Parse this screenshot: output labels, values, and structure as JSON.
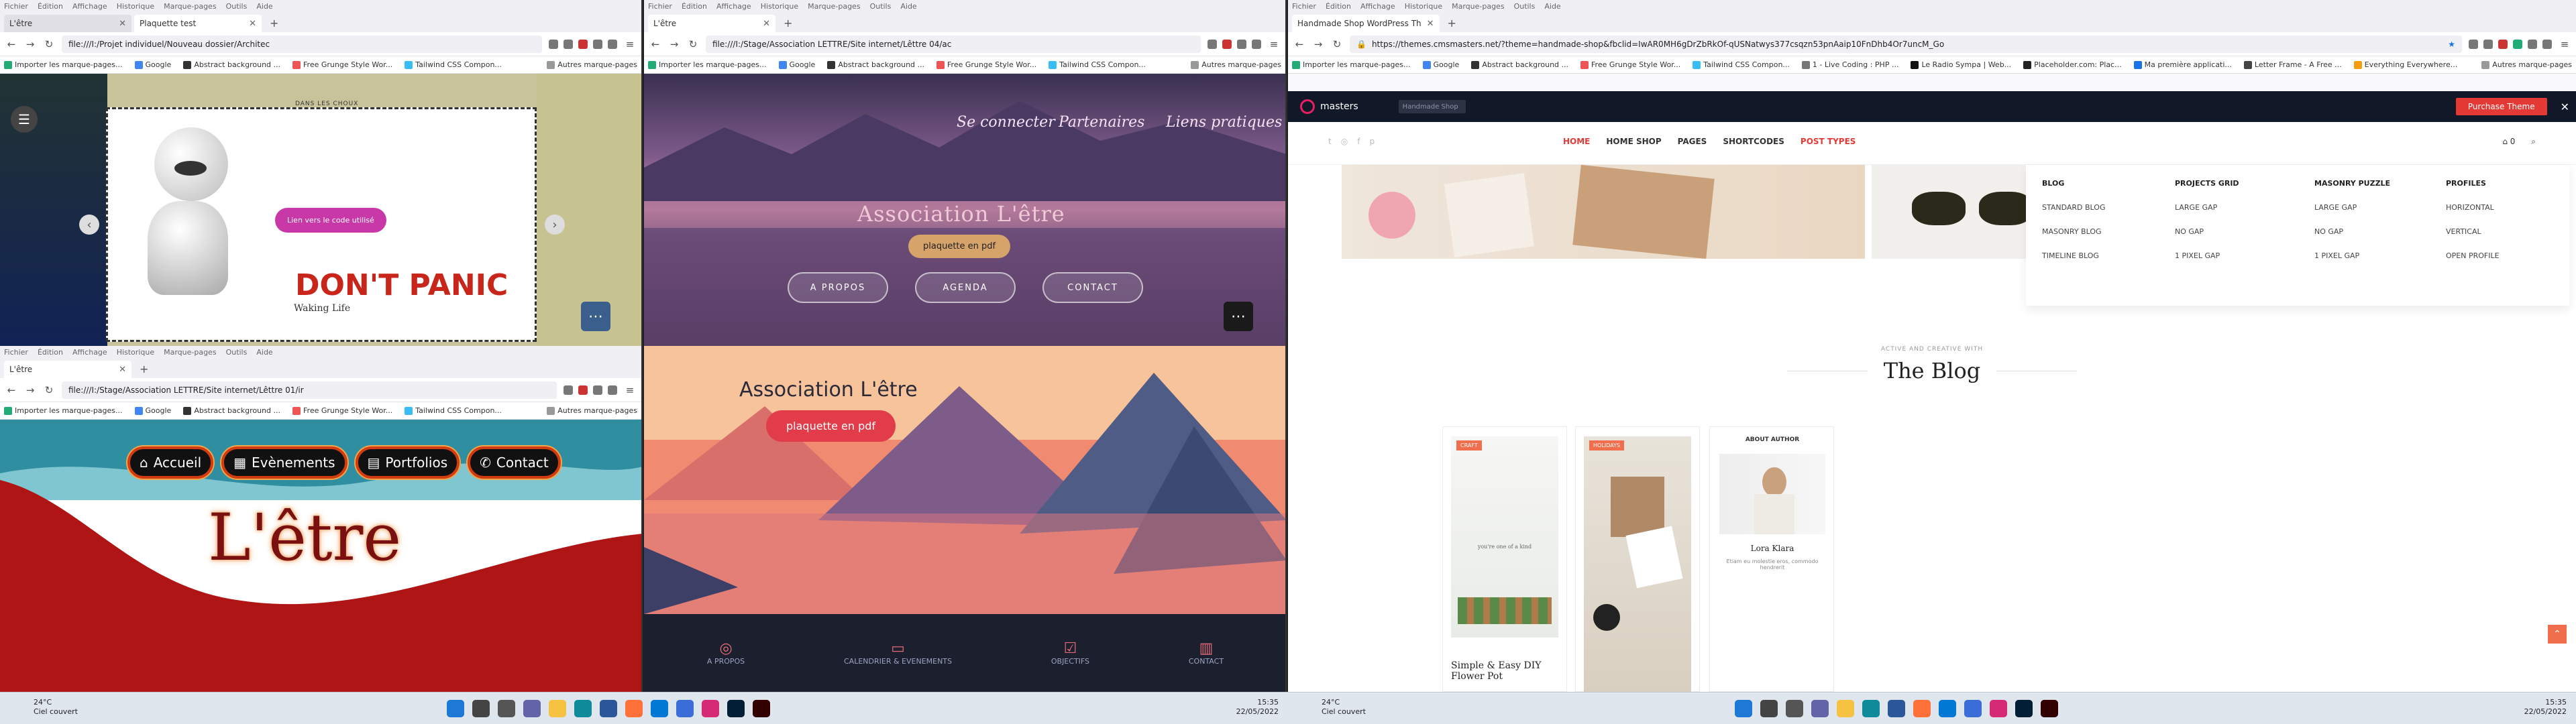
{
  "menus": [
    "Fichier",
    "Édition",
    "Affichage",
    "Historique",
    "Marque-pages",
    "Outils",
    "Aide"
  ],
  "bookmarks_common": [
    "Importer les marque-pages...",
    "Google",
    "Abstract background ...",
    "Free Grunge Style Wor...",
    "Tailwind CSS Compon..."
  ],
  "bookmarks_other": "Autres marque-pages",
  "win1": {
    "tabs": [
      "L'être",
      "Plaquette test"
    ],
    "url": "file:///I:/Projet individuel/Nouveau dossier/Architec",
    "top_small": "DANS LES CHOUX",
    "pill": "Lien vers le code utilisé",
    "dont_panic": "DON'T PANIC",
    "caption": "Waking Life",
    "prev": "‹",
    "next": "›",
    "more": "⋯"
  },
  "win2": {
    "tabs": [
      "L'être"
    ],
    "url": "file:///I:/Stage/Association LETTRE/Site internet/Lêttre 04/ac",
    "nav": [
      "Se connecter",
      "Partenaires",
      "Liens pratiques"
    ],
    "title": "Association L'être",
    "pdf": "plaquette en pdf",
    "buttons": [
      "A PROPOS",
      "AGENDA",
      "CONTACT"
    ],
    "more": "⋯"
  },
  "win3": {
    "tabs": [
      "L'être"
    ],
    "url": "file:///I:/Stage/Association LETTRE/Site internet/Lêttre 01/ir",
    "nav": [
      "Accueil",
      "Evènements",
      "Portfolios",
      "Contact"
    ],
    "title": "L'être"
  },
  "win4": {
    "title": "Association L'être",
    "pdf": "plaquette en pdf",
    "footer": [
      "A PROPOS",
      "CALENDRIER & EVENEMENTS",
      "OBJECTIFS",
      "CONTACT"
    ]
  },
  "win5": {
    "tabs": [
      "Handmade Shop WordPress Th"
    ],
    "url": "https://themes.cmsmasters.net/?theme=handmade-shop&fbclid=IwAR0MH6gDrZbRkOf-qUSNatwys377csqzn53pnAaip10FnDhb4Or7uncM_Go",
    "bookmarks_extra": [
      "1 - Live Coding : PHP ...",
      "Le Radio Sympa | Web...",
      "Placeholder.com: Plac...",
      "Ma première applicati...",
      "Letter Frame - A Free ...",
      "Everything Everywhere..."
    ],
    "brand": "masters",
    "search_label": "Handmade Shop",
    "purchase": "Purchase Theme",
    "main_nav": [
      "HOME",
      "HOME SHOP",
      "PAGES",
      "SHORTCODES",
      "POST TYPES"
    ],
    "cart_count": "0",
    "mega": [
      {
        "head": "BLOG",
        "items": [
          "STANDARD BLOG",
          "MASONRY BLOG",
          "TIMELINE BLOG"
        ]
      },
      {
        "head": "PROJECTS GRID",
        "items": [
          "LARGE GAP",
          "NO GAP",
          "1 PIXEL GAP"
        ]
      },
      {
        "head": "MASONRY PUZZLE",
        "items": [
          "LARGE GAP",
          "NO GAP",
          "1 PIXEL GAP"
        ]
      },
      {
        "head": "PROFILES",
        "items": [
          "HORIZONTAL",
          "VERTICAL",
          "OPEN PROFILE"
        ]
      }
    ],
    "kicker": "ACTIVE AND CREATIVE WITH",
    "heading": "The Blog",
    "card1_tag": "CRAFT",
    "card1_title": "Simple & Easy DIY Flower Pot",
    "card1_caption": "you're one of a kind",
    "card2_tag": "HOLIDAYS",
    "about_head": "ABOUT AUTHOR",
    "about_name": "Lora Klara",
    "about_text": "Etiam eu molestie eros, commodo hendrerit"
  },
  "taskbar": {
    "temp": "24°C",
    "weather": "Ciel couvert",
    "time": "15:35",
    "date": "22/05/2022"
  }
}
